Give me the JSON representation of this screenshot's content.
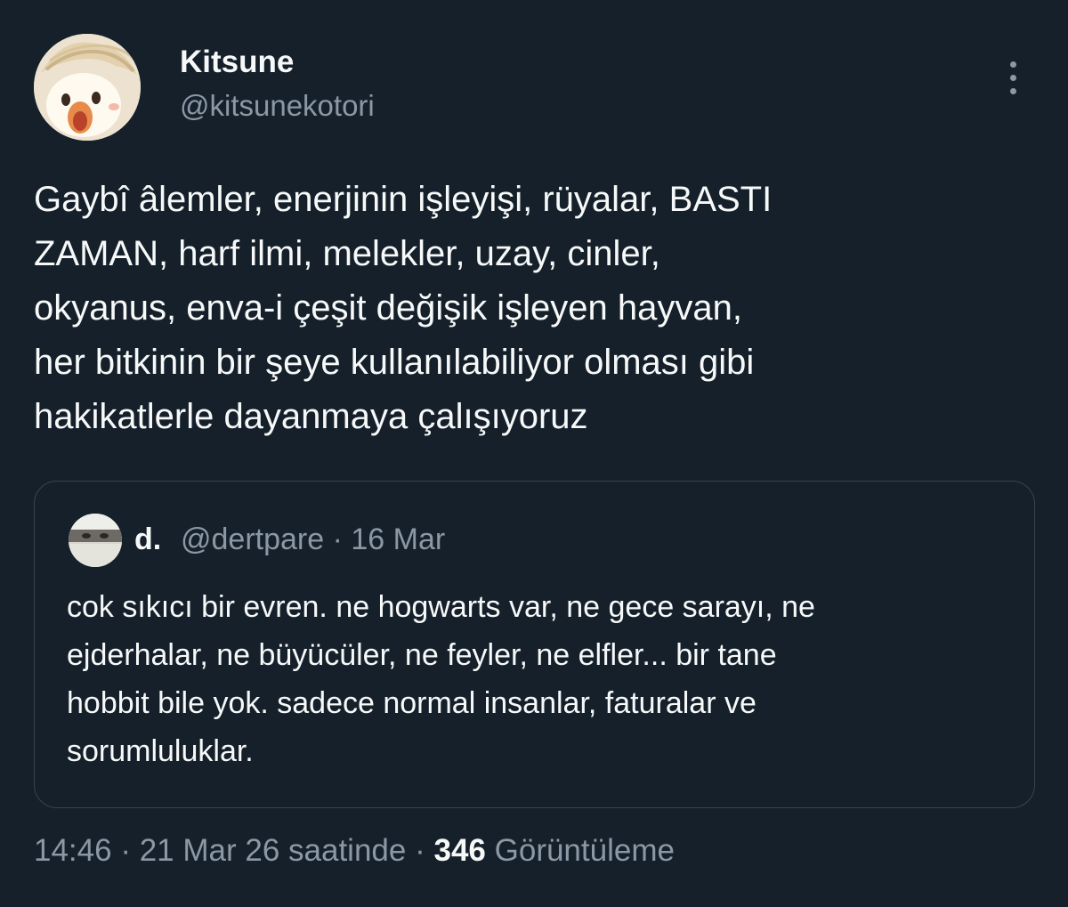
{
  "author": {
    "display_name": "Kitsune",
    "handle": "@kitsunekotori"
  },
  "icons": {
    "more": "more-vertical-icon"
  },
  "tweet": {
    "text": "Gaybî âlemler, enerjinin işleyişi, rüyalar, BASTI\nZAMAN, harf ilmi, melekler, uzay, cinler,\nokyanus, enva-i çeşit değişik işleyen hayvan,\nher bitkinin bir şeye kullanılabiliyor olması gibi\nhakikatlerle dayanmaya çalışıyoruz"
  },
  "quote": {
    "display_name": "d.",
    "handle": "@dertpare",
    "separator": "·",
    "date": "16 Mar",
    "text": "cok sıkıcı bir evren. ne hogwarts var, ne gece sarayı, ne\nejderhalar, ne büyücüler, ne feyler, ne elfler... bir tane\nhobbit bile yok. sadece normal insanlar, faturalar ve\nsorumluluklar."
  },
  "footer": {
    "time": "14:46",
    "separator": "·",
    "date": "21 Mar 26 saatinde",
    "views_count": "346",
    "views_label": "Görüntüleme"
  },
  "colors": {
    "background": "#15202b",
    "text_primary": "#f7f9f9",
    "text_secondary": "#8b98a5",
    "border": "#38444d"
  }
}
